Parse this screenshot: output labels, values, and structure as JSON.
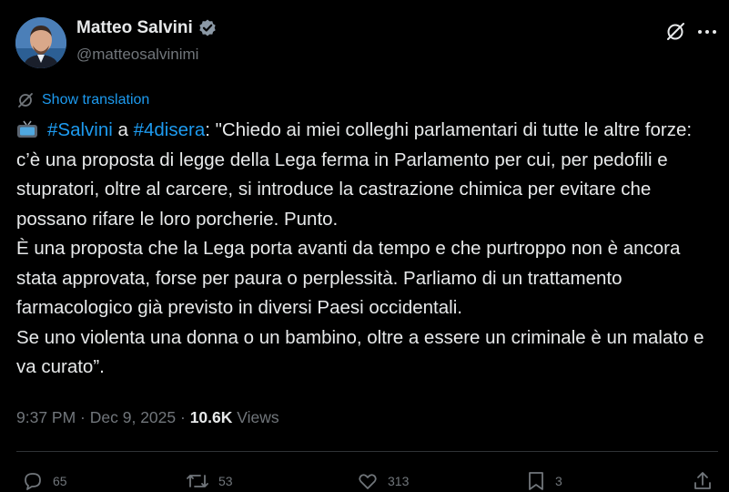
{
  "author": {
    "name": "Matteo Salvini",
    "handle": "@matteosalvinimi",
    "verified": true
  },
  "translate": {
    "label": "Show translation"
  },
  "post": {
    "hashtag1": "#Salvini",
    "connector": " a ",
    "hashtag2": "#4disera",
    "text": ": \"Chiedo ai miei colleghi parlamentari di tutte le altre forze: c’è una proposta di legge della Lega ferma in Parlamento per cui, per pedofili e stupratori, oltre al carcere, si introduce la castrazione chimica per evitare che possano rifare le loro porcherie. Punto.\nÈ una proposta che la Lega porta avanti da tempo e che purtroppo non è ancora stata approvata, forse per paura o perplessità. Parliamo di un trattamento farmacologico già previsto in diversi Paesi occidentali.\nSe uno violenta una donna o un bambino, oltre a essere un criminale è un malato e va curato”."
  },
  "meta": {
    "time": "9:37 PM",
    "sep1": " · ",
    "date": "Dec 9, 2025",
    "sep2": " · ",
    "views_count": "10.6K",
    "views_label": " Views"
  },
  "actions": {
    "replies": "65",
    "reposts": "53",
    "likes": "313",
    "bookmarks": "3"
  },
  "colors": {
    "background": "#000000",
    "text": "#e7e9ea",
    "secondary": "#71767b",
    "accent": "#1d9bf0",
    "divider": "#2f3336"
  },
  "icons": {
    "tv": "tv-emoji-icon",
    "verified": "verified-badge-icon",
    "grok": "grok-icon",
    "more": "more-icon",
    "reply": "reply-icon",
    "repost": "repost-icon",
    "like": "like-icon",
    "bookmark": "bookmark-icon",
    "share": "share-icon"
  }
}
